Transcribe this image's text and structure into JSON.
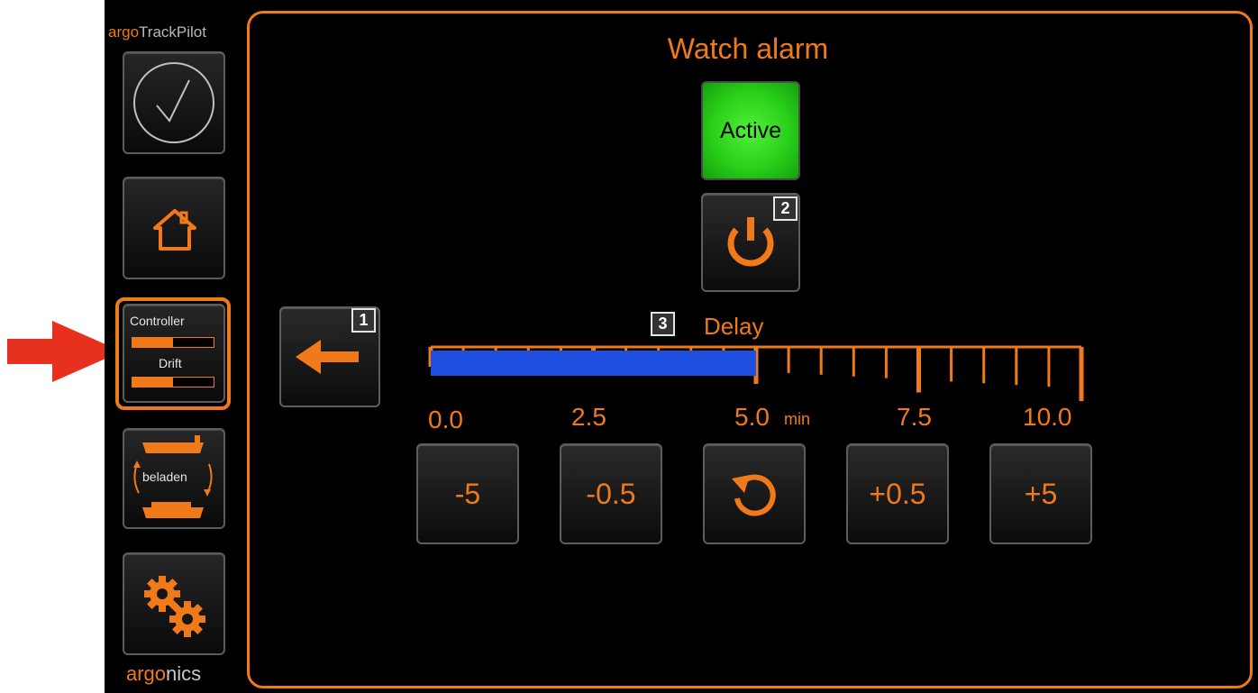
{
  "brand": {
    "top_prefix": "argo",
    "top_suffix": "TrackPilot",
    "bottom_prefix": "argo",
    "bottom_suffix": "nics"
  },
  "sidebar": {
    "controller_label": "Controller",
    "drift_label": "Drift",
    "loaded_label": "beladen",
    "controller_level": 0.5,
    "drift_level": 0.5
  },
  "panel": {
    "title": "Watch alarm",
    "status_label": "Active",
    "badges": {
      "back": "1",
      "power": "2",
      "delay": "3"
    },
    "delay_label": "Delay",
    "delay_value_min": 5.0,
    "scale_min": 0,
    "scale_max": 10,
    "scale_ticks": [
      "0.0",
      "2.5",
      "5.0",
      "7.5",
      "10.0"
    ],
    "unit": "min",
    "step_buttons": {
      "minus_5": "-5",
      "minus_05": "-0.5",
      "plus_05": "+0.5",
      "plus_5": "+5"
    }
  },
  "annotation": {
    "arrow_color": "#e8301f"
  },
  "colors": {
    "accent": "#f07a1a",
    "fill": "#1f4fe0",
    "active": "#2ad11a"
  }
}
